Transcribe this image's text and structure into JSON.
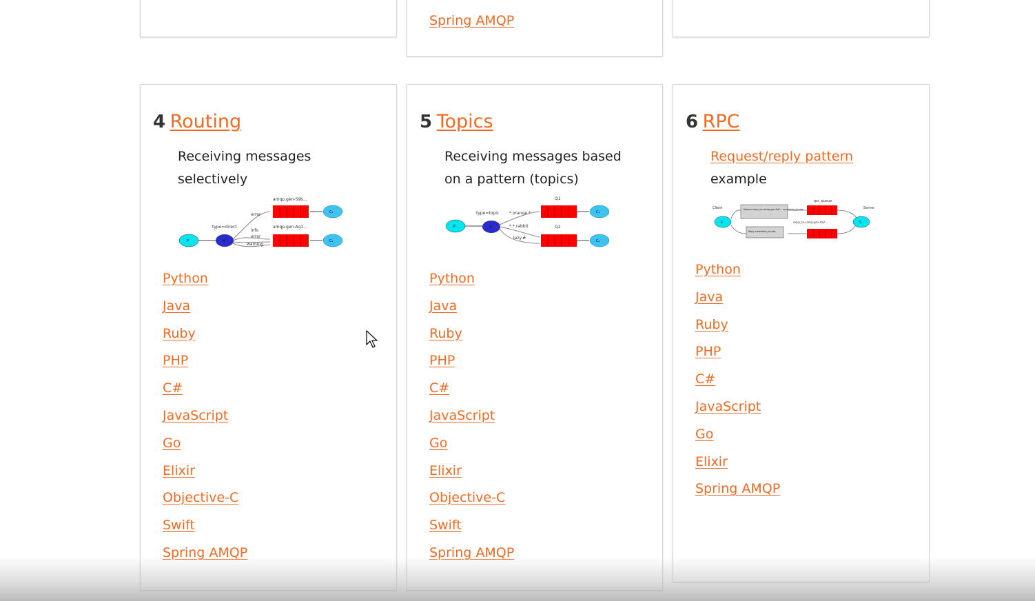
{
  "top_row": {
    "middle_link": "Spring AMQP"
  },
  "tutorials": [
    {
      "number": "4",
      "title": "Routing",
      "description_line1": "Receiving messages",
      "description_line2": "selectively",
      "languages": [
        "Python",
        "Java",
        "Ruby",
        "PHP",
        "C#",
        "JavaScript",
        "Go",
        "Elixir",
        "Objective-C",
        "Swift",
        "Spring AMQP"
      ]
    },
    {
      "number": "5",
      "title": "Topics",
      "description_line1": "Receiving messages based",
      "description_line2": "on a pattern (topics)",
      "languages": [
        "Python",
        "Java",
        "Ruby",
        "PHP",
        "C#",
        "JavaScript",
        "Go",
        "Elixir",
        "Objective-C",
        "Swift",
        "Spring AMQP"
      ]
    },
    {
      "number": "6",
      "title": "RPC",
      "description_link": "Request/reply pattern",
      "description_line2": "example",
      "languages": [
        "Python",
        "Java",
        "Ruby",
        "PHP",
        "C#",
        "JavaScript",
        "Go",
        "Elixir",
        "Spring AMQP"
      ]
    }
  ],
  "diagram_labels": {
    "routing": {
      "p": "P",
      "x": "X",
      "c1": "C₁",
      "c2": "C₂",
      "type": "type=direct",
      "q1": "amqp.gen-S9b...",
      "q2": "amqp.gen-Ag1...",
      "k1": "error",
      "k2": "info",
      "k3": "error",
      "k4": "warning"
    },
    "topics": {
      "p": "P",
      "x": "X",
      "c1": "C₁",
      "c2": "C₂",
      "type": "type=topic",
      "q1": "Q1",
      "q2": "Q2",
      "k1": "*.orange.*",
      "k2": "*.*.rabbit",
      "k3": "lazy.#"
    },
    "rpc": {
      "client": "Client",
      "server": "Server",
      "c": "C",
      "s": "S",
      "req": "Request reply_to=amqp.gen-Xa2... correlation_id=abc",
      "rep": "Reply correlation_id=abc",
      "q1": "rpc_queue",
      "q2": "reply_to=amq.gen-Xa2..."
    }
  },
  "colors": {
    "link": "#f26a21",
    "queue": "#ff0000",
    "producer": "#00e5ee",
    "exchange": "#2b2bc8",
    "consumer": "#3ec2f0"
  }
}
